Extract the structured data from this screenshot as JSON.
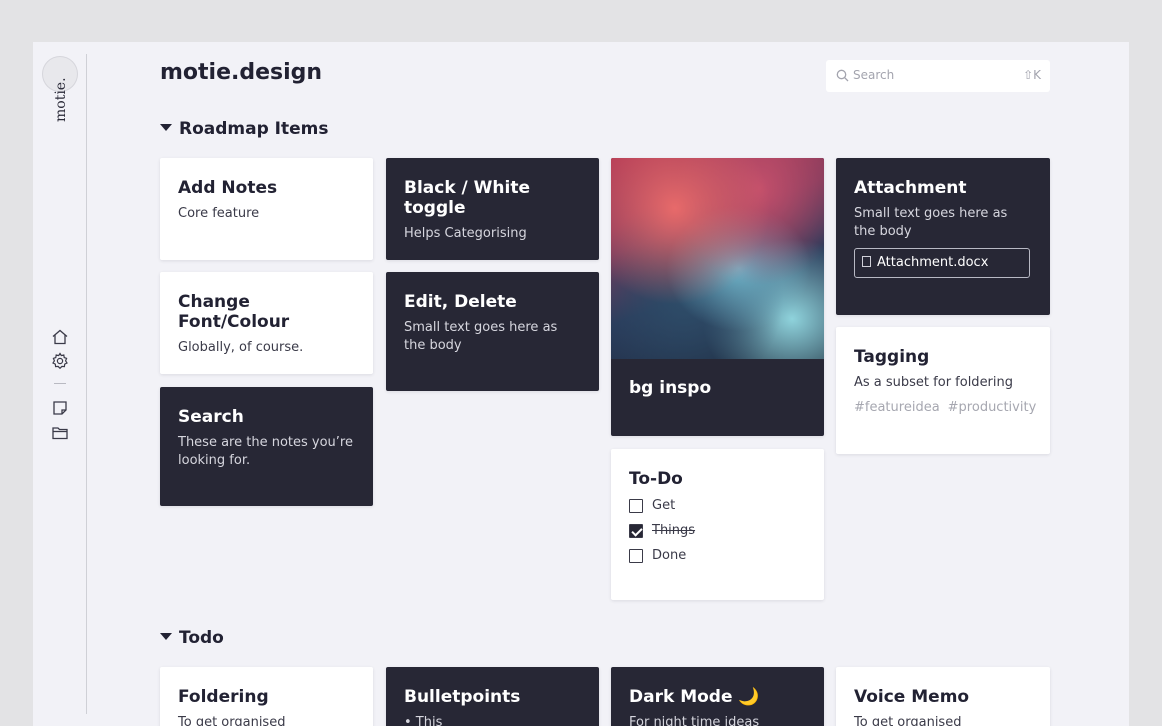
{
  "sidebar": {
    "logo_text": "motie.",
    "icons": [
      "home-icon",
      "settings-icon",
      "note-icon",
      "folder-icon"
    ]
  },
  "header": {
    "title": "motie.design",
    "search_placeholder": "Search",
    "search_shortcut": "⇧K"
  },
  "sections": {
    "roadmap": "Roadmap Items",
    "todo": "Todo"
  },
  "roadmap_cards": {
    "add_notes": {
      "title": "Add Notes",
      "body": "Core feature"
    },
    "change_font": {
      "title": "Change Font/Colour",
      "body": "Globally, of course."
    },
    "search": {
      "title": "Search",
      "body": "These are the notes you’re looking for."
    },
    "toggle": {
      "title": "Black / White toggle",
      "body": "Helps Categorising"
    },
    "edit": {
      "title": "Edit, Delete",
      "body": "Small text goes here as the body"
    },
    "bg_inspo": {
      "title": "bg inspo"
    },
    "todo": {
      "title": "To-Do",
      "items": [
        "Get",
        "Things",
        "Done"
      ],
      "checked": [
        false,
        true,
        false
      ]
    },
    "attachment": {
      "title": "Attachment",
      "body": "Small text goes here as the body",
      "file": "Attachment.docx"
    },
    "tagging": {
      "title": "Tagging",
      "body": "As a subset for foldering",
      "tags": [
        "#featureidea",
        "#productivity"
      ]
    }
  },
  "todo_cards": {
    "foldering": {
      "title": "Foldering",
      "body": "To get organised"
    },
    "bulletpoints": {
      "title": "Bulletpoints",
      "body": "• This"
    },
    "dark_mode": {
      "title": "Dark Mode 🌙",
      "body": "For night time ideas"
    },
    "voice_memo": {
      "title": "Voice Memo",
      "body": "To get organised"
    }
  },
  "colors": {
    "dark_card": "#272735",
    "light_card": "#ffffff",
    "background": "#f2f2f7"
  }
}
